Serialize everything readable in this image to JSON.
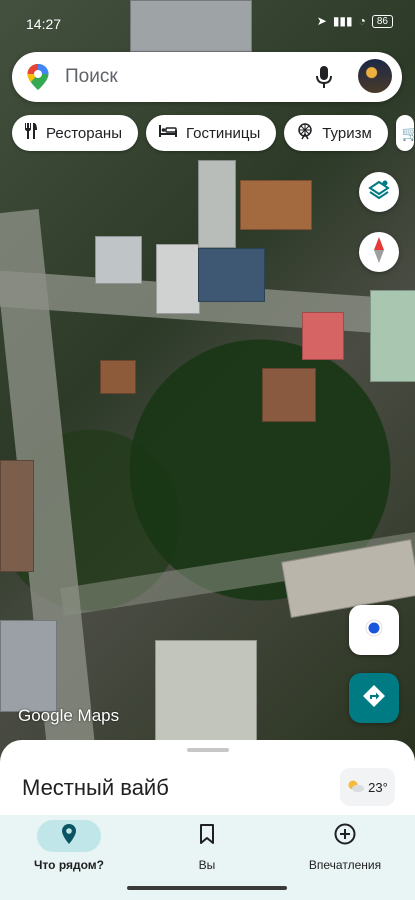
{
  "status_bar": {
    "time": "14:27",
    "battery": "86"
  },
  "search": {
    "placeholder": "Поиск"
  },
  "chips": [
    {
      "label": "Рестораны",
      "icon": "fork-knife-icon"
    },
    {
      "label": "Гостиницы",
      "icon": "bed-icon"
    },
    {
      "label": "Туризм",
      "icon": "ferris-wheel-icon"
    }
  ],
  "map": {
    "attribution": "Google Maps"
  },
  "sheet": {
    "title": "Местный вайб",
    "weather_temp": "23°"
  },
  "nav": {
    "items": [
      {
        "label": "Что рядом?",
        "icon": "place-pin-icon",
        "active": true
      },
      {
        "label": "Вы",
        "icon": "bookmark-icon",
        "active": false
      },
      {
        "label": "Впечатления",
        "icon": "plus-circle-icon",
        "active": false
      }
    ]
  },
  "colors": {
    "accent_teal": "#007b83",
    "active_pill": "#c0e6ea",
    "nav_bg": "#e9f4f4"
  }
}
